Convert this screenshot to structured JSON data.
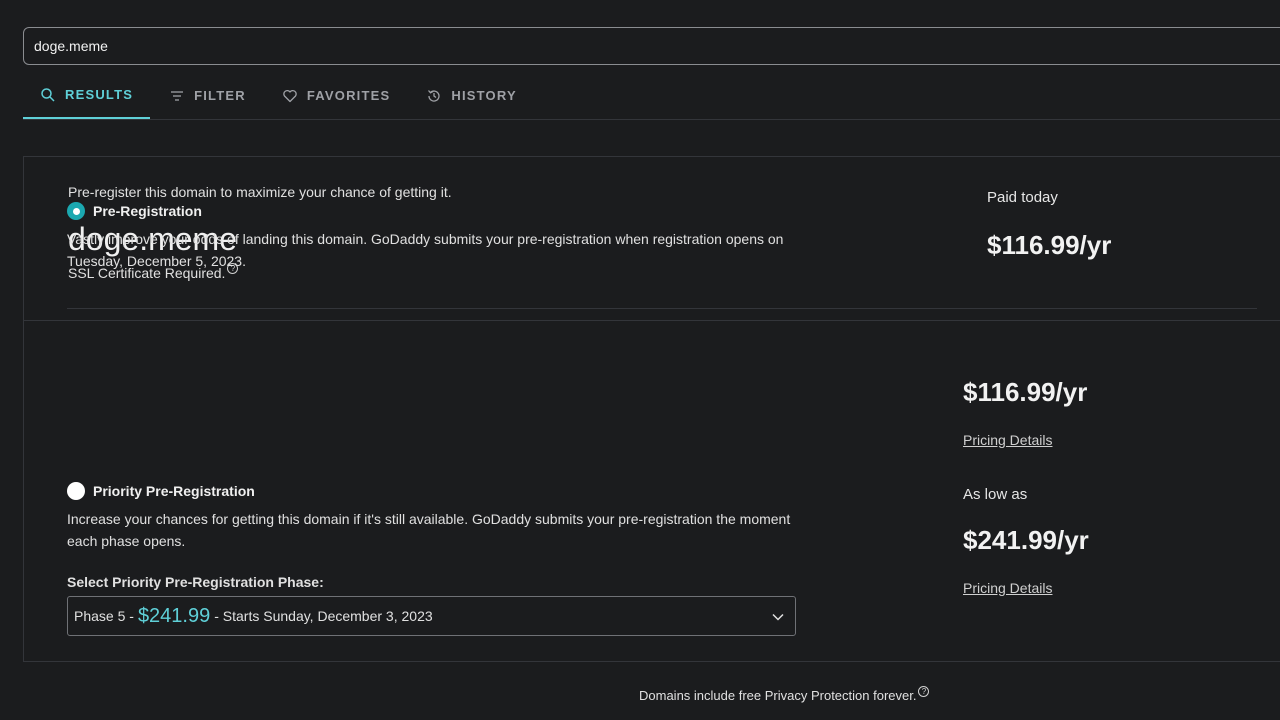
{
  "search": {
    "value": "doge.meme"
  },
  "tabs": [
    {
      "label": "RESULTS",
      "icon": "search-icon",
      "active": true
    },
    {
      "label": "FILTER",
      "icon": "filter-icon",
      "active": false
    },
    {
      "label": "FAVORITES",
      "icon": "heart-icon",
      "active": false
    },
    {
      "label": "HISTORY",
      "icon": "history-icon",
      "active": false
    }
  ],
  "domain_card": {
    "prereg_note": "Pre-register this domain to maximize your chance of getting it.",
    "domain": "doge.meme",
    "ssl_note": "SSL Certificate Required.",
    "paid_label": "Paid today",
    "paid_price": "$116.99/yr"
  },
  "options": [
    {
      "title": "Pre-Registration",
      "selected": true,
      "description": "Vastly improve your odds of landing this domain. GoDaddy submits your pre-registration when registration opens on Tuesday, December 5, 2023.",
      "price": "$116.99/yr",
      "pricing_link": "Pricing Details"
    },
    {
      "title": "Priority Pre-Registration",
      "selected": false,
      "description": "Increase your chances for getting this domain if it's still available. GoDaddy submits your pre-registration the moment each phase opens.",
      "as_low_as": "As low as",
      "price": "$241.99/yr",
      "pricing_link": "Pricing Details",
      "phase_label": "Select Priority Pre-Registration Phase:",
      "phase_select": {
        "prefix": "Phase 5 -",
        "price": "$241.99",
        "suffix": "- Starts Sunday, December 3, 2023"
      }
    }
  ],
  "footer": {
    "note": "Domains include free Privacy Protection forever."
  },
  "colors": {
    "accent": "#5fd0d8",
    "radio_selected": "#1ba8b0",
    "background": "#1b1c1e"
  }
}
